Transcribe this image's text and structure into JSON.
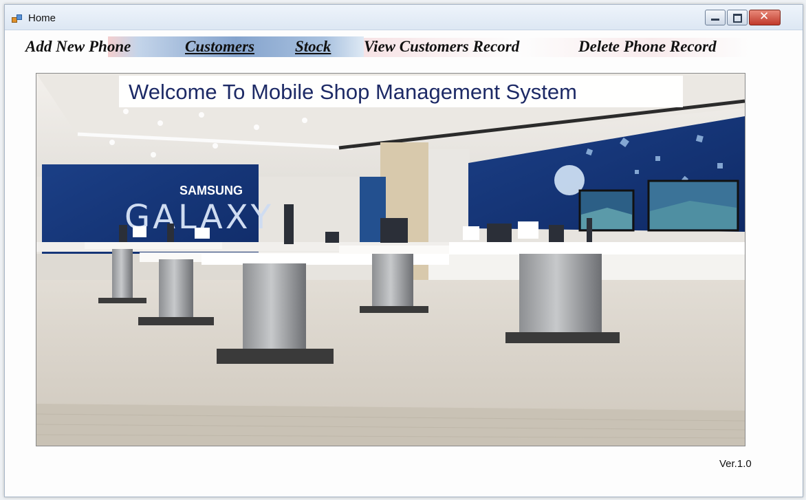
{
  "window": {
    "title": "Home"
  },
  "menu": {
    "items": [
      {
        "label": "Add New Phone"
      },
      {
        "label": "Customers"
      },
      {
        "label": "Stock"
      },
      {
        "label": "View Customers Record"
      },
      {
        "label": "Delete Phone Record"
      }
    ]
  },
  "banner": {
    "text": "Welcome To Mobile Shop Management System"
  },
  "store_image": {
    "brand_line1": "SAMSUNG",
    "brand_line2": "GALAXY"
  },
  "footer": {
    "version": "Ver.1.0"
  },
  "colors": {
    "banner_text": "#1d2a66",
    "menu_highlight": "#6f93c4",
    "close_button": "#c0392b"
  },
  "icons": [
    "app-window-icon",
    "minimize-icon",
    "maximize-icon",
    "close-icon"
  ]
}
